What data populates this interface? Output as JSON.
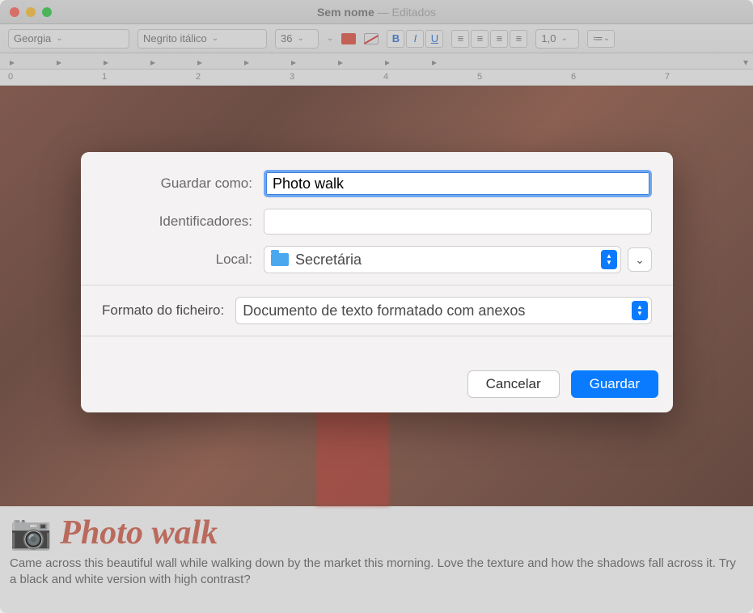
{
  "window": {
    "title": "Sem nome",
    "subtitle": "Editados"
  },
  "toolbar": {
    "font_family": "Georgia",
    "font_style": "Negrito itálico",
    "font_size": "36",
    "line_spacing": "1,0"
  },
  "ruler": {
    "labels": [
      "0",
      "1",
      "2",
      "3",
      "4",
      "5",
      "6",
      "7"
    ]
  },
  "document": {
    "title": "Photo walk",
    "body": "Came across this beautiful wall while walking down by the market this morning. Love the texture and how the shadows fall across it. Try a black and white version with high contrast?"
  },
  "save_dialog": {
    "save_as_label": "Guardar como:",
    "save_as_value": "Photo walk",
    "tags_label": "Identificadores:",
    "tags_value": "",
    "location_label": "Local:",
    "location_value": "Secretária",
    "file_format_label": "Formato do ficheiro:",
    "file_format_value": "Documento de texto formatado com anexos",
    "cancel": "Cancelar",
    "save": "Guardar"
  }
}
